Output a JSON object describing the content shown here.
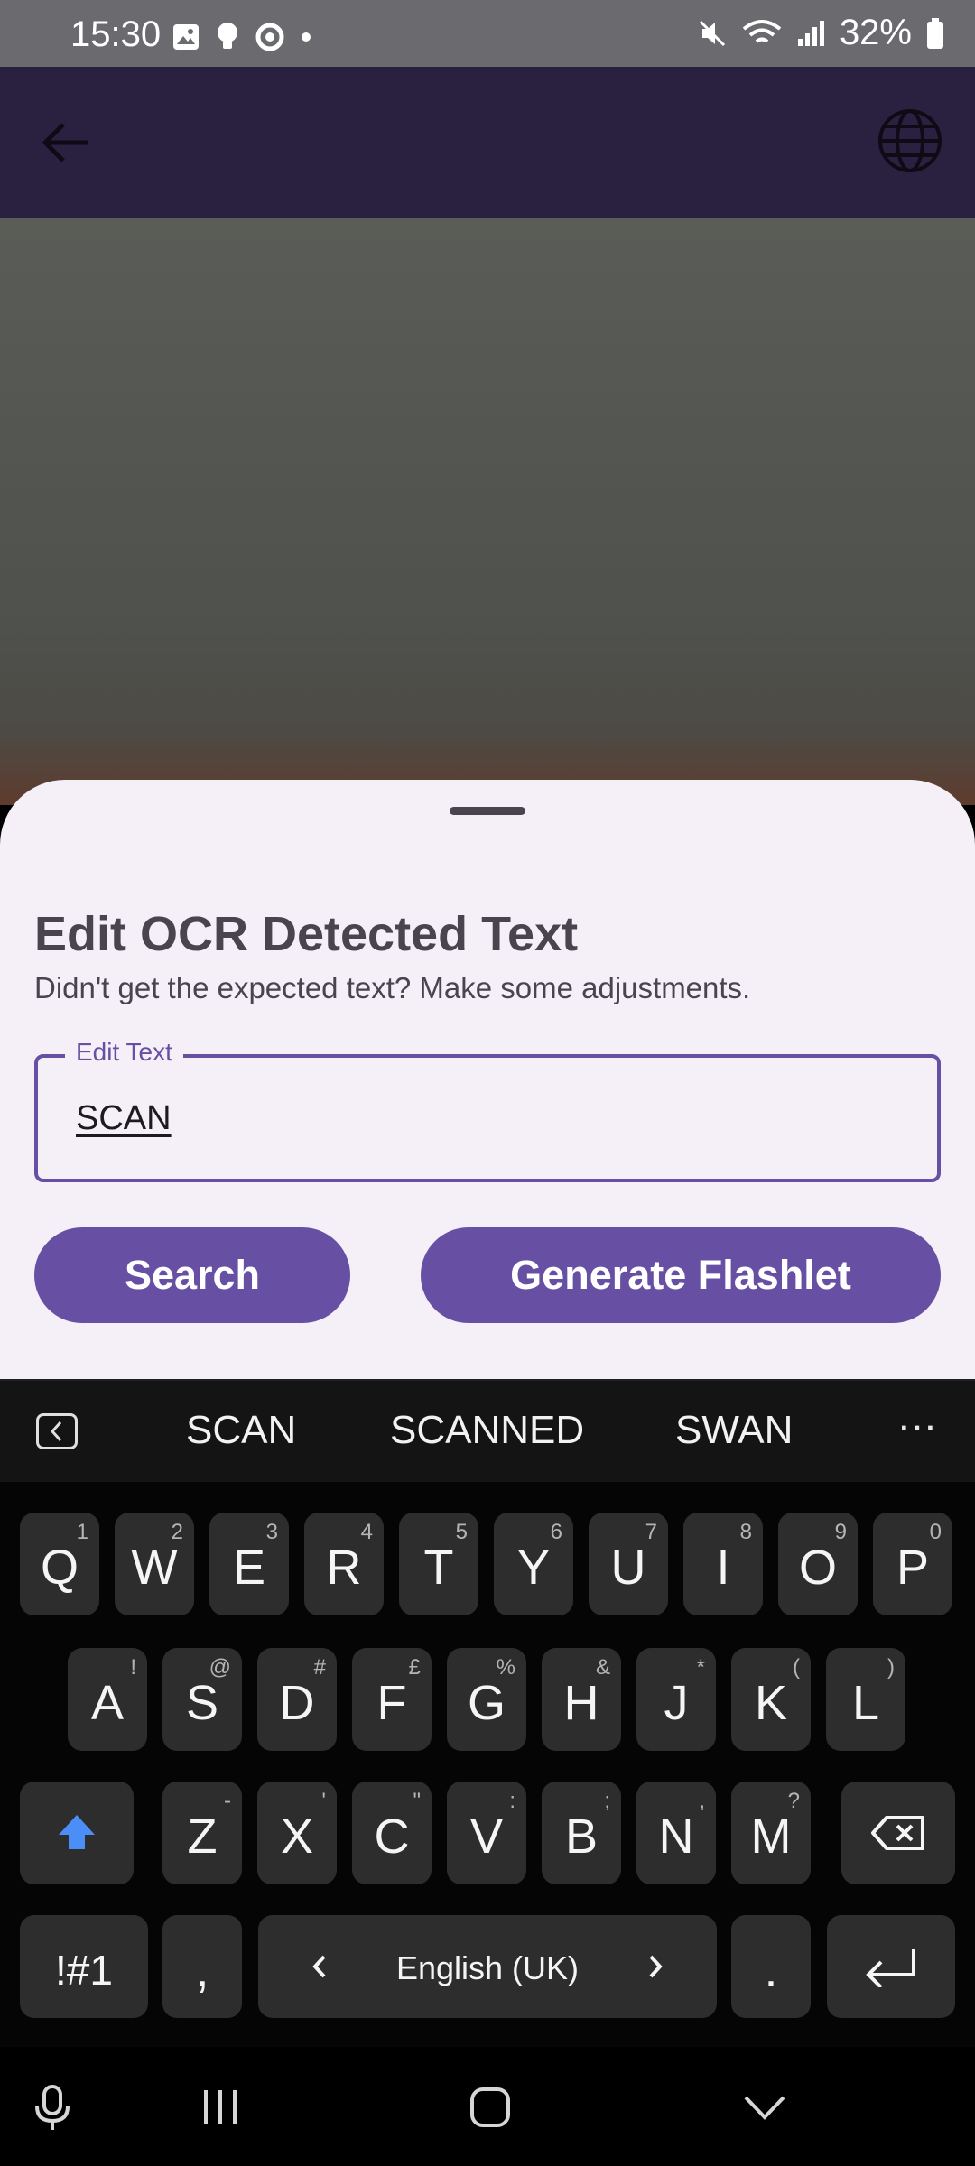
{
  "status_bar": {
    "time": "15:30",
    "battery": "32%",
    "left_icons": [
      "image-icon",
      "bulb-icon",
      "sync-icon",
      "dot-icon"
    ],
    "right_icons": [
      "mute-icon",
      "wifi-icon",
      "signal-icon",
      "battery-icon"
    ]
  },
  "app_bar": {
    "back_icon": "arrow-back-icon",
    "action_icon": "globe-icon",
    "background": "#2a2141"
  },
  "sheet": {
    "title": "Edit OCR Detected Text",
    "subtitle": "Didn't get the expected text? Make some adjustments.",
    "field_label": "Edit Text",
    "field_value": "SCAN",
    "search_label": "Search",
    "generate_label": "Generate Flashlet",
    "accent": "#6750a4"
  },
  "keyboard": {
    "suggestions": [
      "SCAN",
      "SCANNED",
      "SWAN"
    ],
    "more": "⋯",
    "row1": [
      {
        "k": "Q",
        "h": "1"
      },
      {
        "k": "W",
        "h": "2"
      },
      {
        "k": "E",
        "h": "3"
      },
      {
        "k": "R",
        "h": "4"
      },
      {
        "k": "T",
        "h": "5"
      },
      {
        "k": "Y",
        "h": "6"
      },
      {
        "k": "U",
        "h": "7"
      },
      {
        "k": "I",
        "h": "8"
      },
      {
        "k": "O",
        "h": "9"
      },
      {
        "k": "P",
        "h": "0"
      }
    ],
    "row2": [
      {
        "k": "A",
        "h": "!"
      },
      {
        "k": "S",
        "h": "@"
      },
      {
        "k": "D",
        "h": "#"
      },
      {
        "k": "F",
        "h": "£"
      },
      {
        "k": "G",
        "h": "%"
      },
      {
        "k": "H",
        "h": "&"
      },
      {
        "k": "J",
        "h": "*"
      },
      {
        "k": "K",
        "h": "("
      },
      {
        "k": "L",
        "h": ")"
      }
    ],
    "row3": [
      {
        "k": "Z",
        "h": "-"
      },
      {
        "k": "X",
        "h": "'"
      },
      {
        "k": "C",
        "h": "\""
      },
      {
        "k": "V",
        "h": ":"
      },
      {
        "k": "B",
        "h": ";"
      },
      {
        "k": "N",
        "h": ","
      },
      {
        "k": "M",
        "h": "?"
      }
    ],
    "symbols_label": "!#1",
    "comma_label": ",",
    "space_label": "English (UK)",
    "period_label": ".",
    "shift_color": "#4c8ef7"
  },
  "nav_bar": {
    "icons": [
      "mic-icon",
      "recents-icon",
      "home-icon",
      "hide-keyboard-icon"
    ]
  }
}
